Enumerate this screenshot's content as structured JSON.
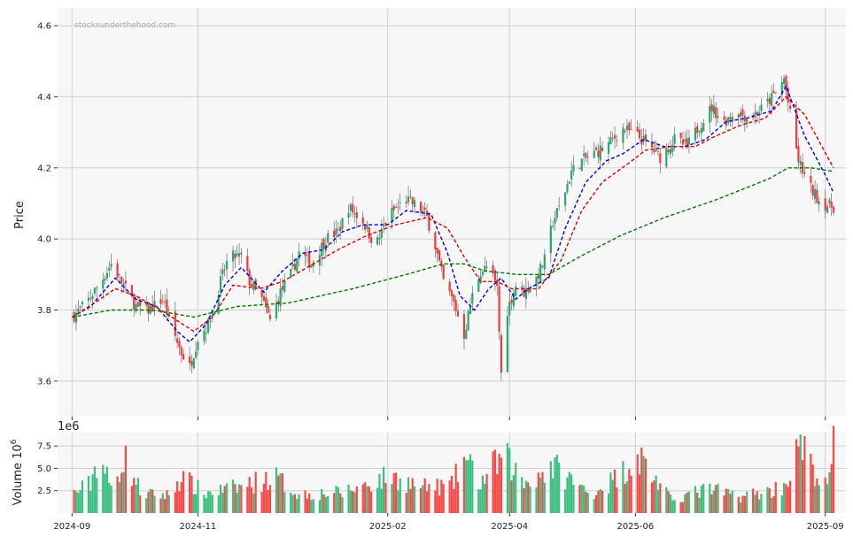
{
  "chart_data": [
    {
      "type": "candlestick",
      "ylabel": "Price",
      "watermark": "stocksunderthehood.com",
      "ylim": [
        3.5,
        4.65
      ],
      "yticks": [
        3.6,
        3.8,
        4.0,
        4.2,
        4.4,
        4.6
      ],
      "ytick_labels": [
        "3.6",
        "3.8",
        "4.0",
        "4.2",
        "4.4",
        "4.6"
      ],
      "grid": true,
      "colors": {
        "up": "#26a96c",
        "down": "#f03b3b",
        "wick": "#555555",
        "panel_bg": "#f7f7f7",
        "grid": "#d0d0d0"
      },
      "series": [
        {
          "style": "dashed",
          "color": "#0000dd",
          "role": "fast moving average",
          "anchors": [
            [
              "2024-09-01",
              3.78
            ],
            [
              "2024-09-10",
              3.81
            ],
            [
              "2024-09-22",
              3.89
            ],
            [
              "2024-10-02",
              3.83
            ],
            [
              "2024-10-12",
              3.81
            ],
            [
              "2024-10-22",
              3.74
            ],
            [
              "2024-10-28",
              3.71
            ],
            [
              "2024-11-05",
              3.76
            ],
            [
              "2024-11-14",
              3.87
            ],
            [
              "2024-11-22",
              3.92
            ],
            [
              "2024-12-03",
              3.85
            ],
            [
              "2024-12-12",
              3.91
            ],
            [
              "2024-12-22",
              3.96
            ],
            [
              "2025-01-01",
              3.97
            ],
            [
              "2025-01-10",
              4.02
            ],
            [
              "2025-01-20",
              4.04
            ],
            [
              "2025-02-01",
              4.04
            ],
            [
              "2025-02-10",
              4.08
            ],
            [
              "2025-02-22",
              4.07
            ],
            [
              "2025-03-02",
              3.96
            ],
            [
              "2025-03-08",
              3.84
            ],
            [
              "2025-03-15",
              3.8
            ],
            [
              "2025-03-22",
              3.86
            ],
            [
              "2025-03-28",
              3.89
            ],
            [
              "2025-04-04",
              3.83
            ],
            [
              "2025-04-10",
              3.86
            ],
            [
              "2025-04-20",
              3.89
            ],
            [
              "2025-04-28",
              4.03
            ],
            [
              "2025-05-08",
              4.16
            ],
            [
              "2025-05-18",
              4.22
            ],
            [
              "2025-05-26",
              4.24
            ],
            [
              "2025-06-05",
              4.28
            ],
            [
              "2025-06-15",
              4.26
            ],
            [
              "2025-06-25",
              4.26
            ],
            [
              "2025-07-05",
              4.28
            ],
            [
              "2025-07-15",
              4.33
            ],
            [
              "2025-07-25",
              4.34
            ],
            [
              "2025-08-06",
              4.36
            ],
            [
              "2025-08-13",
              4.43
            ],
            [
              "2025-08-22",
              4.29
            ],
            [
              "2025-09-01",
              4.18
            ],
            [
              "2025-09-05",
              4.13
            ]
          ]
        },
        {
          "style": "dashed",
          "color": "#dd0000",
          "role": "medium moving average",
          "anchors": [
            [
              "2024-09-01",
              3.78
            ],
            [
              "2024-09-12",
              3.82
            ],
            [
              "2024-09-22",
              3.86
            ],
            [
              "2024-10-02",
              3.84
            ],
            [
              "2024-10-14",
              3.8
            ],
            [
              "2024-10-22",
              3.77
            ],
            [
              "2024-10-30",
              3.74
            ],
            [
              "2024-11-08",
              3.78
            ],
            [
              "2024-11-18",
              3.87
            ],
            [
              "2024-12-01",
              3.86
            ],
            [
              "2024-12-12",
              3.88
            ],
            [
              "2024-12-24",
              3.92
            ],
            [
              "2025-01-08",
              3.97
            ],
            [
              "2025-01-22",
              4.01
            ],
            [
              "2025-02-05",
              4.04
            ],
            [
              "2025-02-20",
              4.06
            ],
            [
              "2025-03-02",
              4.03
            ],
            [
              "2025-03-10",
              3.95
            ],
            [
              "2025-03-18",
              3.88
            ],
            [
              "2025-03-26",
              3.88
            ],
            [
              "2025-04-02",
              3.86
            ],
            [
              "2025-04-15",
              3.86
            ],
            [
              "2025-04-26",
              3.94
            ],
            [
              "2025-05-06",
              4.08
            ],
            [
              "2025-05-16",
              4.16
            ],
            [
              "2025-05-28",
              4.21
            ],
            [
              "2025-06-06",
              4.25
            ],
            [
              "2025-06-18",
              4.26
            ],
            [
              "2025-06-30",
              4.26
            ],
            [
              "2025-07-10",
              4.29
            ],
            [
              "2025-07-22",
              4.32
            ],
            [
              "2025-08-03",
              4.34
            ],
            [
              "2025-08-13",
              4.4
            ],
            [
              "2025-08-22",
              4.35
            ],
            [
              "2025-09-05",
              4.2
            ]
          ]
        },
        {
          "style": "dashed",
          "color": "#007700",
          "role": "slow moving average",
          "anchors": [
            [
              "2024-09-01",
              3.78
            ],
            [
              "2024-09-20",
              3.8
            ],
            [
              "2024-10-10",
              3.8
            ],
            [
              "2024-10-30",
              3.78
            ],
            [
              "2024-11-20",
              3.81
            ],
            [
              "2024-12-15",
              3.82
            ],
            [
              "2025-01-15",
              3.86
            ],
            [
              "2025-02-10",
              3.9
            ],
            [
              "2025-02-28",
              3.93
            ],
            [
              "2025-03-10",
              3.93
            ],
            [
              "2025-03-20",
              3.91
            ],
            [
              "2025-04-05",
              3.9
            ],
            [
              "2025-04-20",
              3.9
            ],
            [
              "2025-05-05",
              3.95
            ],
            [
              "2025-05-25",
              4.01
            ],
            [
              "2025-06-15",
              4.06
            ],
            [
              "2025-07-10",
              4.11
            ],
            [
              "2025-08-05",
              4.17
            ],
            [
              "2025-08-14",
              4.2
            ],
            [
              "2025-08-25",
              4.2
            ],
            [
              "2025-09-05",
              4.19
            ]
          ]
        }
      ],
      "close_anchors": [
        [
          "2024-09-01",
          3.78
        ],
        [
          "2024-09-08",
          3.82
        ],
        [
          "2024-09-15",
          3.88
        ],
        [
          "2024-09-20",
          3.93
        ],
        [
          "2024-09-25",
          3.88
        ],
        [
          "2024-10-02",
          3.81
        ],
        [
          "2024-10-08",
          3.8
        ],
        [
          "2024-10-15",
          3.83
        ],
        [
          "2024-10-20",
          3.74
        ],
        [
          "2024-10-24",
          3.68
        ],
        [
          "2024-10-28",
          3.64
        ],
        [
          "2024-11-01",
          3.72
        ],
        [
          "2024-11-06",
          3.76
        ],
        [
          "2024-11-12",
          3.88
        ],
        [
          "2024-11-16",
          3.95
        ],
        [
          "2024-11-22",
          3.95
        ],
        [
          "2024-11-26",
          3.88
        ],
        [
          "2024-12-02",
          3.83
        ],
        [
          "2024-12-06",
          3.77
        ],
        [
          "2024-12-11",
          3.85
        ],
        [
          "2024-12-16",
          3.9
        ],
        [
          "2024-12-20",
          3.96
        ],
        [
          "2024-12-26",
          3.93
        ],
        [
          "2025-01-02",
          4.0
        ],
        [
          "2025-01-08",
          4.02
        ],
        [
          "2025-01-13",
          4.09
        ],
        [
          "2025-01-20",
          4.05
        ],
        [
          "2025-01-26",
          3.98
        ],
        [
          "2025-02-02",
          4.07
        ],
        [
          "2025-02-10",
          4.11
        ],
        [
          "2025-02-16",
          4.09
        ],
        [
          "2025-02-20",
          4.06
        ],
        [
          "2025-02-24",
          3.98
        ],
        [
          "2025-02-28",
          3.88
        ],
        [
          "2025-03-05",
          3.82
        ],
        [
          "2025-03-10",
          3.73
        ],
        [
          "2025-03-14",
          3.84
        ],
        [
          "2025-03-18",
          3.91
        ],
        [
          "2025-03-22",
          3.92
        ],
        [
          "2025-03-26",
          3.86
        ],
        [
          "2025-03-28",
          3.62
        ],
        [
          "2025-03-31",
          3.8
        ],
        [
          "2025-04-04",
          3.87
        ],
        [
          "2025-04-08",
          3.85
        ],
        [
          "2025-04-14",
          3.89
        ],
        [
          "2025-04-18",
          3.94
        ],
        [
          "2025-04-22",
          4.05
        ],
        [
          "2025-04-26",
          4.1
        ],
        [
          "2025-05-01",
          4.19
        ],
        [
          "2025-05-06",
          4.22
        ],
        [
          "2025-05-12",
          4.24
        ],
        [
          "2025-05-18",
          4.26
        ],
        [
          "2025-05-26",
          4.31
        ],
        [
          "2025-06-02",
          4.29
        ],
        [
          "2025-06-08",
          4.26
        ],
        [
          "2025-06-13",
          4.23
        ],
        [
          "2025-06-20",
          4.28
        ],
        [
          "2025-06-26",
          4.26
        ],
        [
          "2025-07-02",
          4.32
        ],
        [
          "2025-07-08",
          4.37
        ],
        [
          "2025-07-14",
          4.33
        ],
        [
          "2025-07-20",
          4.36
        ],
        [
          "2025-07-26",
          4.34
        ],
        [
          "2025-08-02",
          4.37
        ],
        [
          "2025-08-08",
          4.41
        ],
        [
          "2025-08-12",
          4.45
        ],
        [
          "2025-08-15",
          4.35
        ],
        [
          "2025-08-19",
          4.22
        ],
        [
          "2025-08-24",
          4.15
        ],
        [
          "2025-08-30",
          4.1
        ],
        [
          "2025-09-05",
          4.09
        ]
      ]
    },
    {
      "type": "bar",
      "ylabel": "Volume  10",
      "ylabel_exponent": "6",
      "offset_label": "1e6",
      "ylim": [
        0,
        9
      ],
      "yticks": [
        2.5,
        5.0,
        7.5
      ],
      "ytick_labels": [
        "2.5",
        "5.0",
        "7.5"
      ],
      "grid": true,
      "x_range": [
        "2024-08-25",
        "2025-09-11"
      ],
      "xticks": [
        "2024-09-01",
        "2024-11-01",
        "2025-02-01",
        "2025-04-01",
        "2025-06-01",
        "2025-09-01"
      ],
      "xtick_labels": [
        "2024-09",
        "2024-11",
        "2025-02",
        "2025-04",
        "2025-06",
        "2025-09"
      ],
      "volume_anchors": [
        [
          "2024-09-01",
          2.2
        ],
        [
          "2024-09-10",
          3.5
        ],
        [
          "2024-09-14",
          7.0
        ],
        [
          "2024-09-20",
          2.8
        ],
        [
          "2024-09-26",
          6.6
        ],
        [
          "2024-10-05",
          2.2
        ],
        [
          "2024-10-18",
          2.1
        ],
        [
          "2024-10-24",
          4.3
        ],
        [
          "2024-11-04",
          2.3
        ],
        [
          "2024-11-20",
          3.0
        ],
        [
          "2024-12-08",
          4.3
        ],
        [
          "2024-12-20",
          2.2
        ],
        [
          "2025-01-10",
          2.4
        ],
        [
          "2025-02-02",
          4.3
        ],
        [
          "2025-02-18",
          3.0
        ],
        [
          "2025-03-04",
          3.2
        ],
        [
          "2025-03-10",
          6.4
        ],
        [
          "2025-03-18",
          3.5
        ],
        [
          "2025-03-26",
          6.0
        ],
        [
          "2025-03-30",
          6.5
        ],
        [
          "2025-04-08",
          3.5
        ],
        [
          "2025-04-22",
          5.5
        ],
        [
          "2025-05-10",
          2.2
        ],
        [
          "2025-05-24",
          4.3
        ],
        [
          "2025-06-02",
          6.9
        ],
        [
          "2025-06-18",
          1.6
        ],
        [
          "2025-07-06",
          2.8
        ],
        [
          "2025-07-22",
          2.0
        ],
        [
          "2025-08-06",
          2.6
        ],
        [
          "2025-08-13",
          3.5
        ],
        [
          "2025-08-16",
          5.5
        ],
        [
          "2025-08-20",
          8.0
        ],
        [
          "2025-08-26",
          5.0
        ],
        [
          "2025-09-02",
          2.9
        ],
        [
          "2025-09-05",
          7.8
        ]
      ]
    }
  ]
}
